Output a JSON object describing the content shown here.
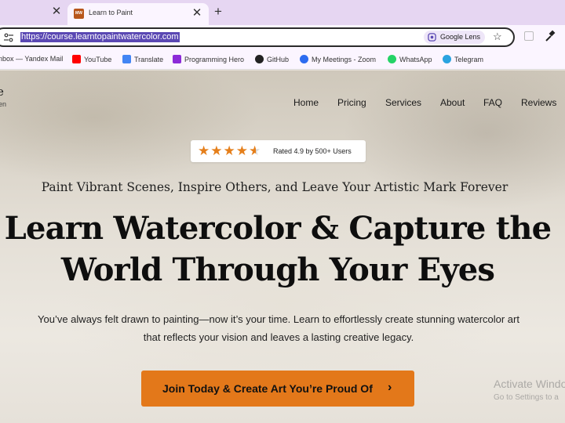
{
  "browser": {
    "tabs": [
      {
        "title": "Learn to Paint",
        "favicon_text": "MW",
        "active": true
      }
    ],
    "url": "https://course.learntopaintwatercolor.com",
    "lens_label": "Google Lens",
    "bookmarks": [
      {
        "label": "nbox — Yandex Mail",
        "icon": "mail-icon",
        "color": "#e33b2e"
      },
      {
        "label": "YouTube",
        "icon": "youtube-icon",
        "color": "#ff0000"
      },
      {
        "label": "Translate",
        "icon": "translate-icon",
        "color": "#4285f4"
      },
      {
        "label": "Programming Hero",
        "icon": "programming-hero-icon",
        "color": "#8c2bd8"
      },
      {
        "label": "GitHub",
        "icon": "github-icon",
        "color": "#222222"
      },
      {
        "label": "My Meetings - Zoom",
        "icon": "zoom-icon",
        "color": "#2d6cf0"
      },
      {
        "label": "WhatsApp",
        "icon": "whatsapp-icon",
        "color": "#25d366"
      },
      {
        "label": "Telegram",
        "icon": "telegram-icon",
        "color": "#2aa3e0"
      }
    ]
  },
  "page": {
    "logo_fragment": "e",
    "logo_sub_fragment": "en",
    "nav": [
      "Home",
      "Pricing",
      "Services",
      "About",
      "FAQ",
      "Reviews"
    ],
    "rating": {
      "text": "Rated 4.9 by 500+ Users",
      "stars": 4.5
    },
    "tagline": "Paint Vibrant Scenes, Inspire Others, and Leave Your Artistic Mark Forever",
    "headline_line1": "Learn Watercolor & Capture the",
    "headline_line2": "World Through Your Eyes",
    "description_line1": "You’ve always felt drawn to painting—now it’s your time. Learn to effortlessly create stunning watercolor art",
    "description_line2": "that reflects your vision and leaves a lasting creative legacy.",
    "cta_label": "Join Today & Create Art You’re Proud Of",
    "accent_color": "#e3781a"
  },
  "os_watermark": {
    "title": "Activate Windo",
    "subtitle": "Go to Settings to a"
  }
}
